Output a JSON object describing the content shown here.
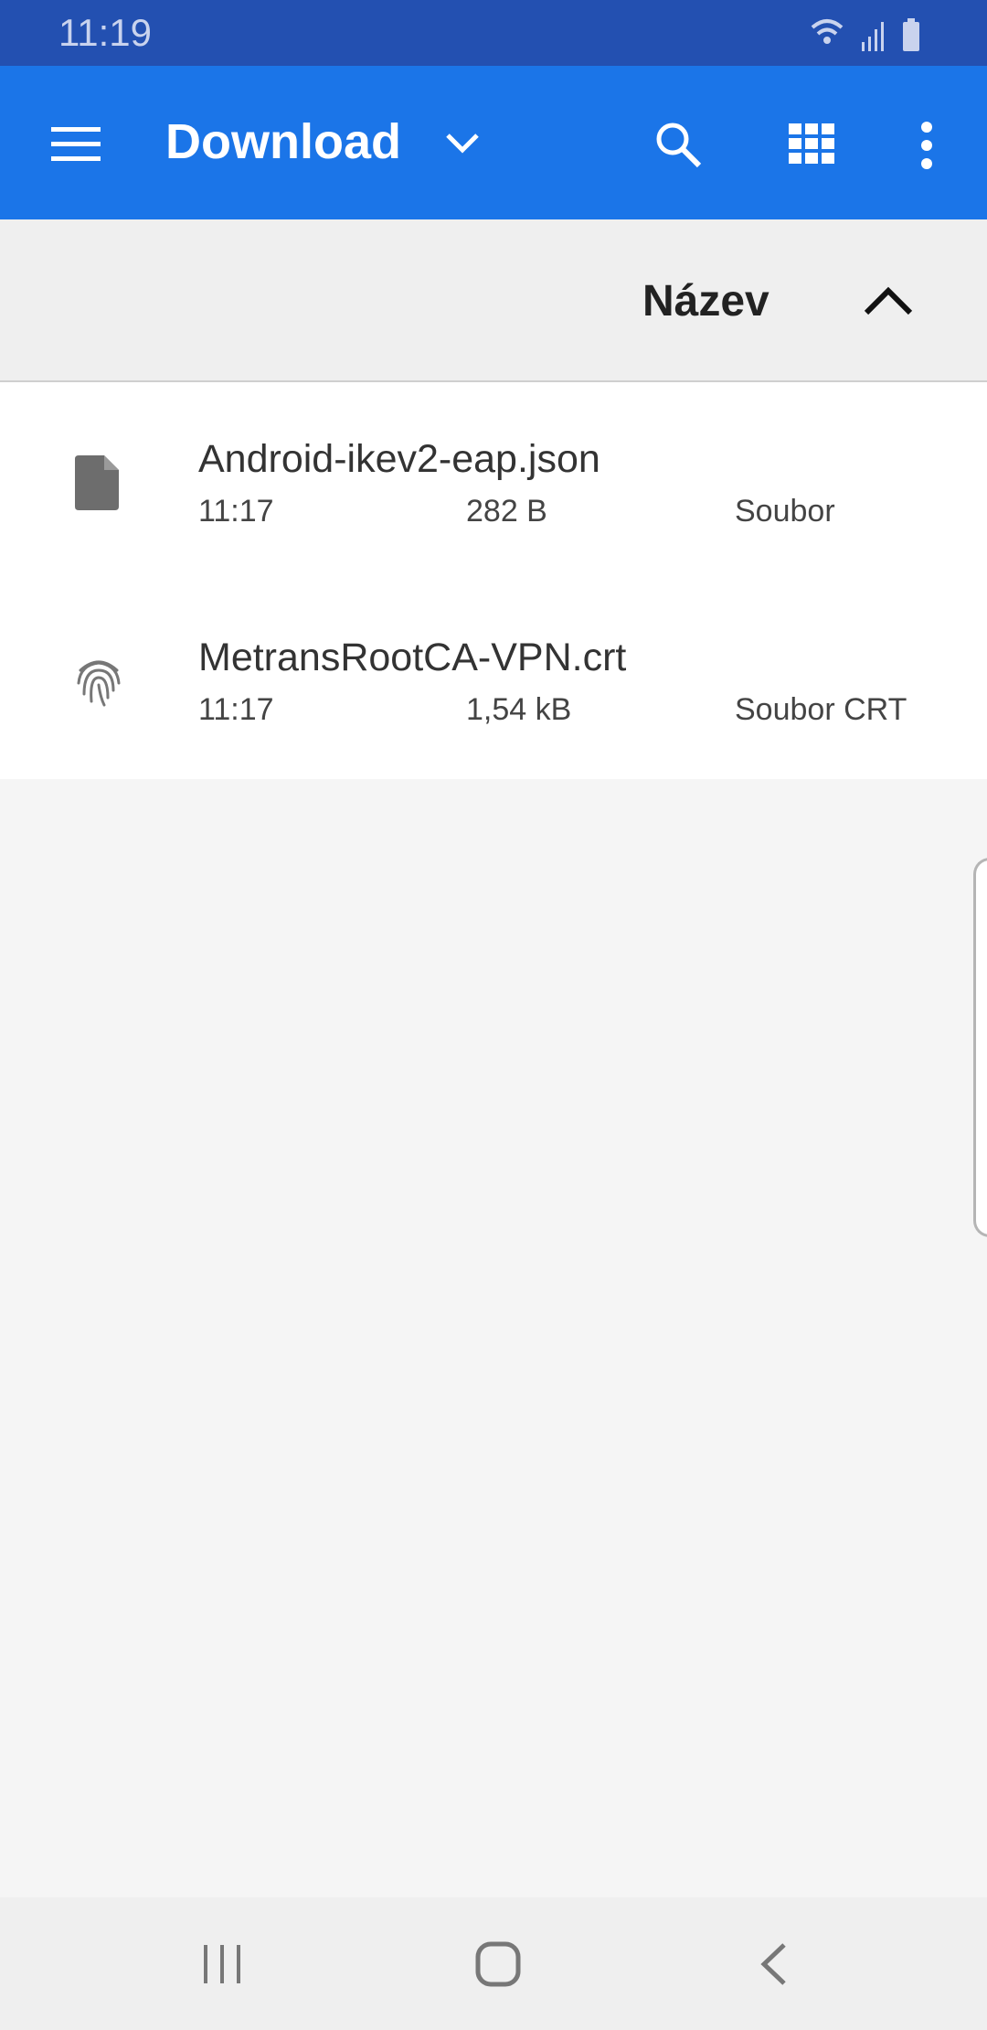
{
  "status_bar": {
    "time": "11:19",
    "icons": [
      "wifi-icon",
      "signal-icon",
      "battery-icon"
    ]
  },
  "app_bar": {
    "title": "Download",
    "icons": [
      "menu-icon",
      "chevron-down-icon",
      "search-icon",
      "grid-view-icon",
      "more-vert-icon"
    ]
  },
  "sort": {
    "label": "Název",
    "direction": "ascending"
  },
  "files": [
    {
      "name": "Android-ikev2-eap.json",
      "time": "11:17",
      "size": "282 B",
      "type": "Soubor",
      "icon": "file-icon"
    },
    {
      "name": "MetransRootCA-VPN.crt",
      "time": "11:17",
      "size": "1,54 kB",
      "type": "Soubor CRT",
      "icon": "fingerprint-icon"
    }
  ],
  "colors": {
    "status_bar": "#2350b1",
    "app_bar": "#1b75e8"
  }
}
